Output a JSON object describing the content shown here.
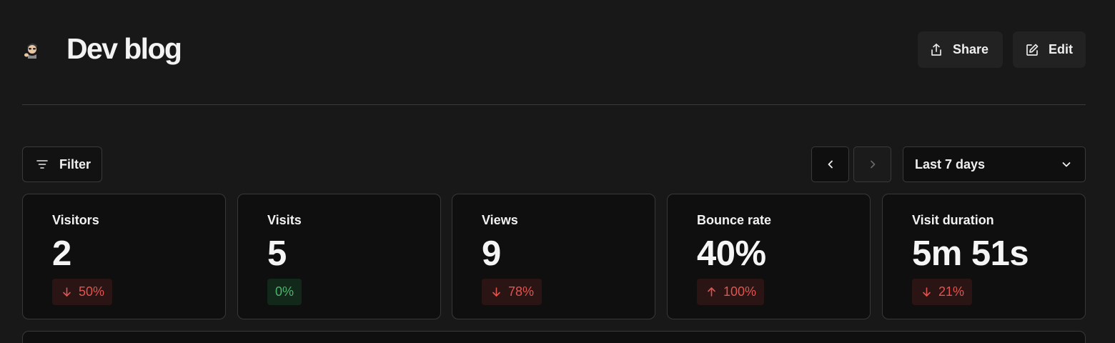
{
  "site": {
    "title": "Dev blog",
    "avatar": "avatar-emoji-icon"
  },
  "header": {
    "share_label": "Share",
    "share_icon": "share-icon",
    "edit_label": "Edit",
    "edit_icon": "edit-icon"
  },
  "toolbar": {
    "filter_label": "Filter",
    "filter_icon": "filter-icon",
    "prev_icon": "chevron-left-icon",
    "next_icon": "chevron-right-icon",
    "date_range": "Last 7 days",
    "date_icon": "chevron-down-icon"
  },
  "stats": [
    {
      "label": "Visitors",
      "value": "2",
      "change": "50%",
      "direction": "down",
      "sentiment": "negative"
    },
    {
      "label": "Visits",
      "value": "5",
      "change": "0%",
      "direction": "none",
      "sentiment": "positive"
    },
    {
      "label": "Views",
      "value": "9",
      "change": "78%",
      "direction": "down",
      "sentiment": "negative"
    },
    {
      "label": "Bounce rate",
      "value": "40%",
      "change": "100%",
      "direction": "up",
      "sentiment": "negative"
    },
    {
      "label": "Visit duration",
      "value": "5m 51s",
      "change": "21%",
      "direction": "down",
      "sentiment": "negative"
    }
  ],
  "colors": {
    "background": "#181818",
    "card": "#0f0f0f",
    "negative": "#e0554f",
    "positive": "#4db36b"
  }
}
